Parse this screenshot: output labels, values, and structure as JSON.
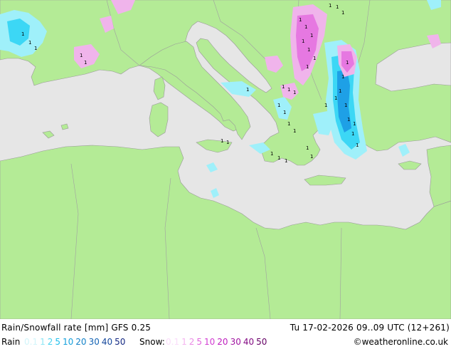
{
  "footer": {
    "title": "Rain/Snowfall rate [mm] GFS 0.25",
    "valid": "Tu 17-02-2026 09..09 UTC (12+261)",
    "rain_label": "Rain",
    "snow_label": "Snow:",
    "credit": "©weatheronline.co.uk"
  },
  "legend": {
    "rain": [
      {
        "label": "0.1",
        "color": "#d2f5fa"
      },
      {
        "label": "1",
        "color": "#8ee6f5"
      },
      {
        "label": "2",
        "color": "#46d2f0"
      },
      {
        "label": "5",
        "color": "#1ebeeb"
      },
      {
        "label": "10",
        "color": "#14a0dc"
      },
      {
        "label": "20",
        "color": "#1482c8"
      },
      {
        "label": "30",
        "color": "#1464b4"
      },
      {
        "label": "40",
        "color": "#14469b"
      },
      {
        "label": "50",
        "color": "#142882"
      }
    ],
    "snow": [
      {
        "label": "0.1",
        "color": "#fadcfa"
      },
      {
        "label": "1",
        "color": "#f5b4f0"
      },
      {
        "label": "2",
        "color": "#eb8ce6"
      },
      {
        "label": "5",
        "color": "#e164dc"
      },
      {
        "label": "10",
        "color": "#d23cd2"
      },
      {
        "label": "20",
        "color": "#be1ebe"
      },
      {
        "label": "30",
        "color": "#a014a0"
      },
      {
        "label": "40",
        "color": "#820a82"
      },
      {
        "label": "50",
        "color": "#640064"
      }
    ]
  },
  "colors": {
    "sea": "#e6e6e6",
    "land": "#b4eb96",
    "border": "#a0a0a0",
    "rain_light": "#9ff0fa",
    "rain_medium": "#3cd7f5",
    "rain_heavy": "#1ea0e6",
    "snow_light": "#f0b4eb",
    "snow_medium": "#e678e1"
  },
  "map_marker_glyph": "1"
}
